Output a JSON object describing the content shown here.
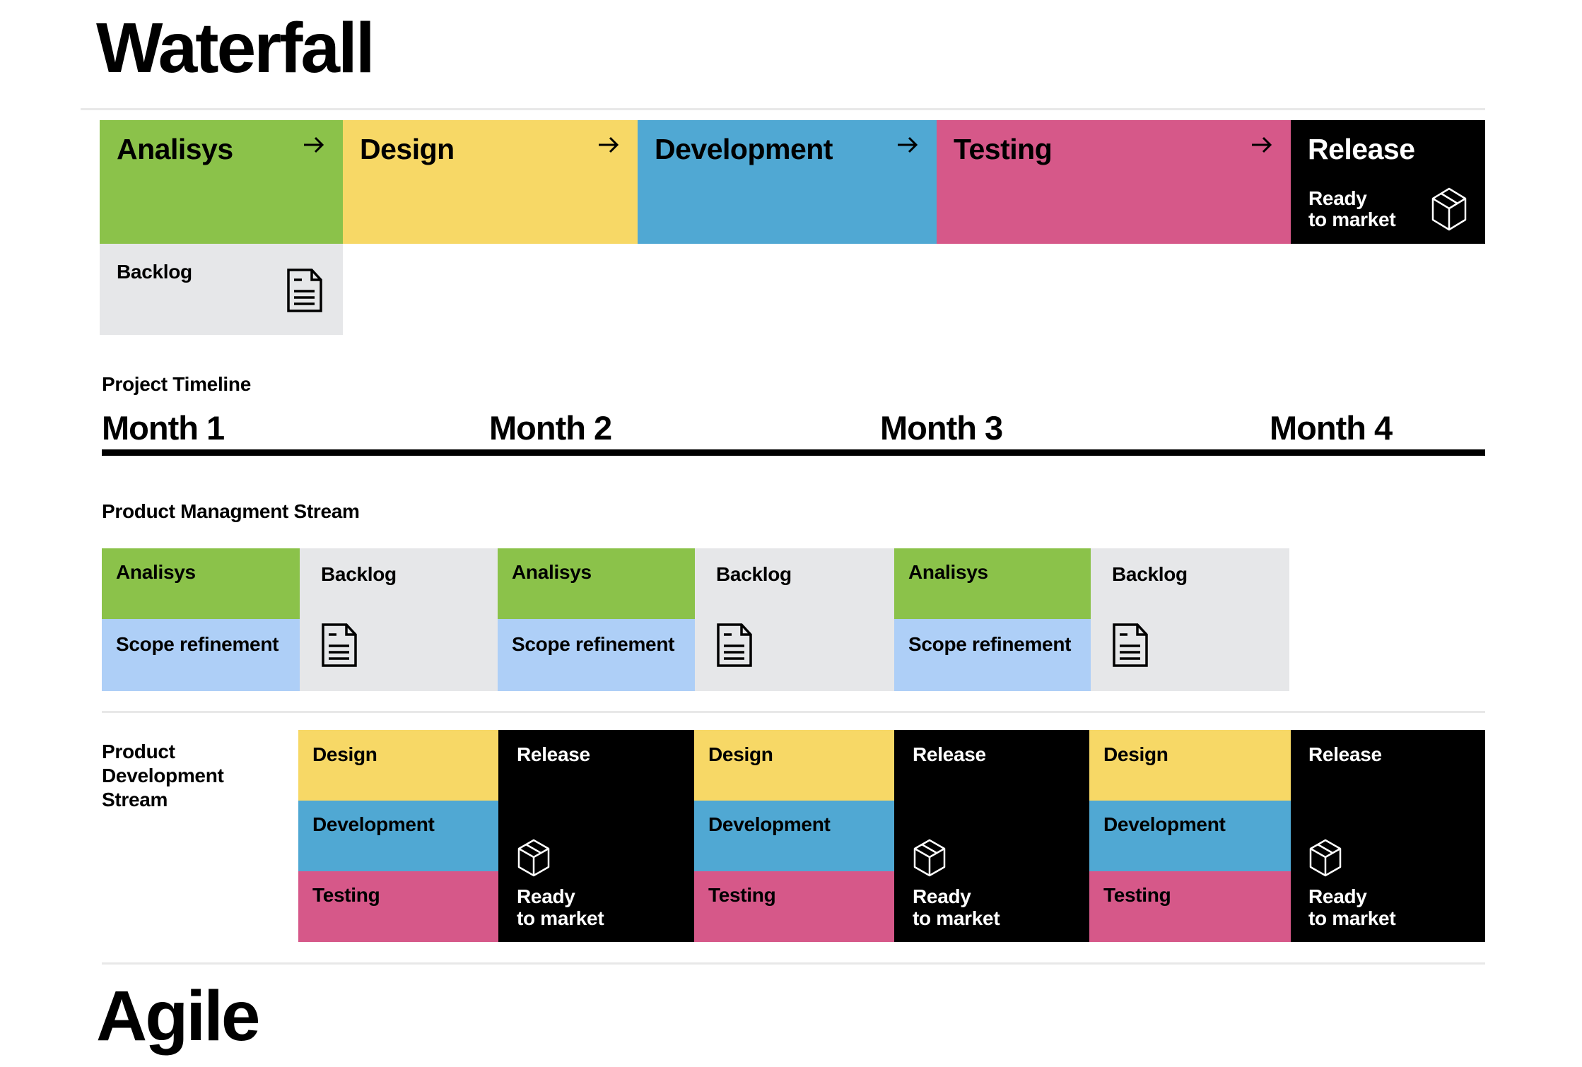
{
  "title": "Waterfall",
  "phases": [
    {
      "label": "Analisys",
      "arrow": "arrow-right-icon",
      "color": "#8bc24a"
    },
    {
      "label": "Design",
      "arrow": "arrow-right-icon",
      "color": "#f7d866"
    },
    {
      "label": "Development",
      "arrow": "arrow-right-icon",
      "color": "#50a8d3"
    },
    {
      "label": "Testing",
      "arrow": "arrow-right-icon",
      "color": "#d65889"
    },
    {
      "label": "Release",
      "sub_line1": "Ready",
      "sub_line2": "to market",
      "icon": "box-icon",
      "color": "#000000"
    }
  ],
  "backlog": {
    "label": "Backlog",
    "icon": "document-icon"
  },
  "timeline": {
    "label": "Project Timeline",
    "months": [
      "Month 1",
      "Month 2",
      "Month 3",
      "Month 4"
    ]
  },
  "pm_stream": {
    "label": "Product Managment Stream",
    "blocks": [
      {
        "analysis": "Analisys",
        "scope": "Scope refinement",
        "backlog": "Backlog"
      },
      {
        "analysis": "Analisys",
        "scope": "Scope refinement",
        "backlog": "Backlog"
      },
      {
        "analysis": "Analisys",
        "scope": "Scope refinement",
        "backlog": "Backlog"
      }
    ]
  },
  "pd_stream": {
    "label_line1": "Product",
    "label_line2": "Development",
    "label_line3": "Stream",
    "blocks": [
      {
        "design": "Design",
        "development": "Development",
        "testing": "Testing",
        "release": "Release",
        "ready1": "Ready",
        "ready2": "to market"
      },
      {
        "design": "Design",
        "development": "Development",
        "testing": "Testing",
        "release": "Release",
        "ready1": "Ready",
        "ready2": "to market"
      },
      {
        "design": "Design",
        "development": "Development",
        "testing": "Testing",
        "release": "Release",
        "ready1": "Ready",
        "ready2": "to market"
      }
    ]
  },
  "next_section_title": "Agile"
}
